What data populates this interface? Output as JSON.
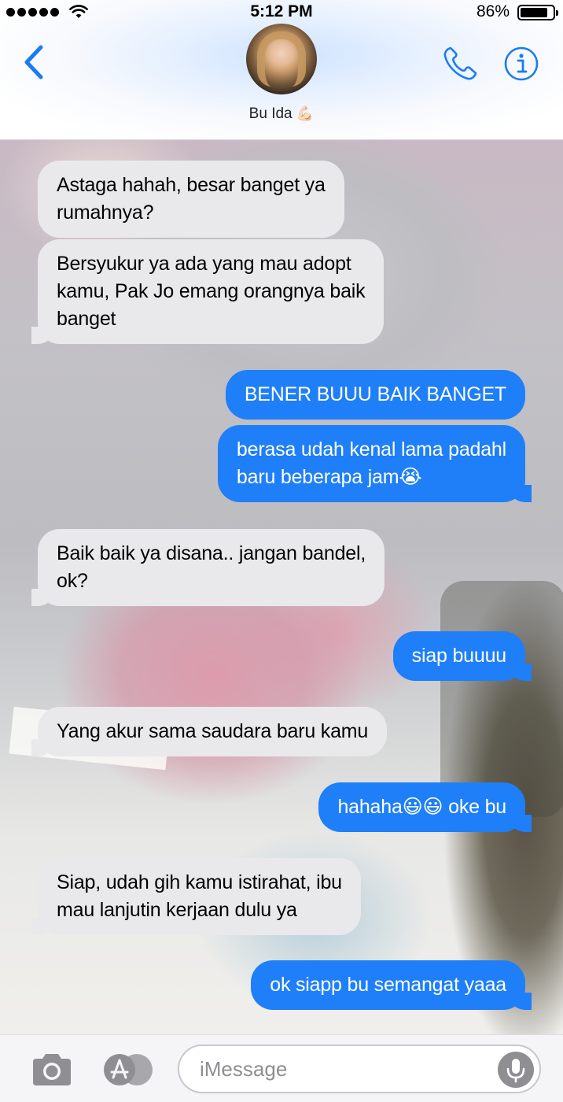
{
  "status_bar": {
    "time": "5:12 PM",
    "battery_percent": "86%",
    "battery_level": 0.86,
    "signal_dots": 5,
    "wifi_icon": "wifi-icon"
  },
  "header": {
    "back_icon": "chevron-left-icon",
    "contact_name": "Bu Ida",
    "contact_emoji": "💪🏻",
    "phone_icon": "phone-icon",
    "info_icon": "info-icon",
    "accent_color": "#1a7cf5"
  },
  "messages": [
    {
      "direction": "in",
      "lines": [
        "Astaga hahah, besar banget ya",
        "rumahnya?"
      ]
    },
    {
      "direction": "in",
      "lines": [
        "Bersyukur ya ada yang mau adopt",
        "kamu, Pak Jo emang orangnya baik",
        "banget"
      ]
    },
    {
      "direction": "out",
      "lines": [
        "BENER BUUU BAIK BANGET"
      ]
    },
    {
      "direction": "out",
      "lines": [
        "berasa udah kenal lama padahl",
        "baru beberapa jam😭"
      ]
    },
    {
      "direction": "in",
      "lines": [
        "Baik baik ya disana.. jangan bandel,",
        "ok?"
      ]
    },
    {
      "direction": "out",
      "lines": [
        "siap buuuu"
      ]
    },
    {
      "direction": "in",
      "lines": [
        "Yang akur sama saudara baru kamu"
      ]
    },
    {
      "direction": "out",
      "lines": [
        "hahaha😃😃 oke bu"
      ]
    },
    {
      "direction": "in",
      "lines": [
        "Siap, udah gih kamu istirahat, ibu",
        "mau lanjutin kerjaan dulu ya"
      ]
    },
    {
      "direction": "out",
      "lines": [
        "ok siapp bu semangat yaaa"
      ]
    }
  ],
  "colors": {
    "incoming_bubble": "#e9e9eb",
    "outgoing_bubble": "#1f7ff8"
  },
  "input_bar": {
    "camera_icon": "camera-icon",
    "apps_icon": "app-store-icon",
    "placeholder": "iMessage",
    "mic_icon": "microphone-icon"
  }
}
